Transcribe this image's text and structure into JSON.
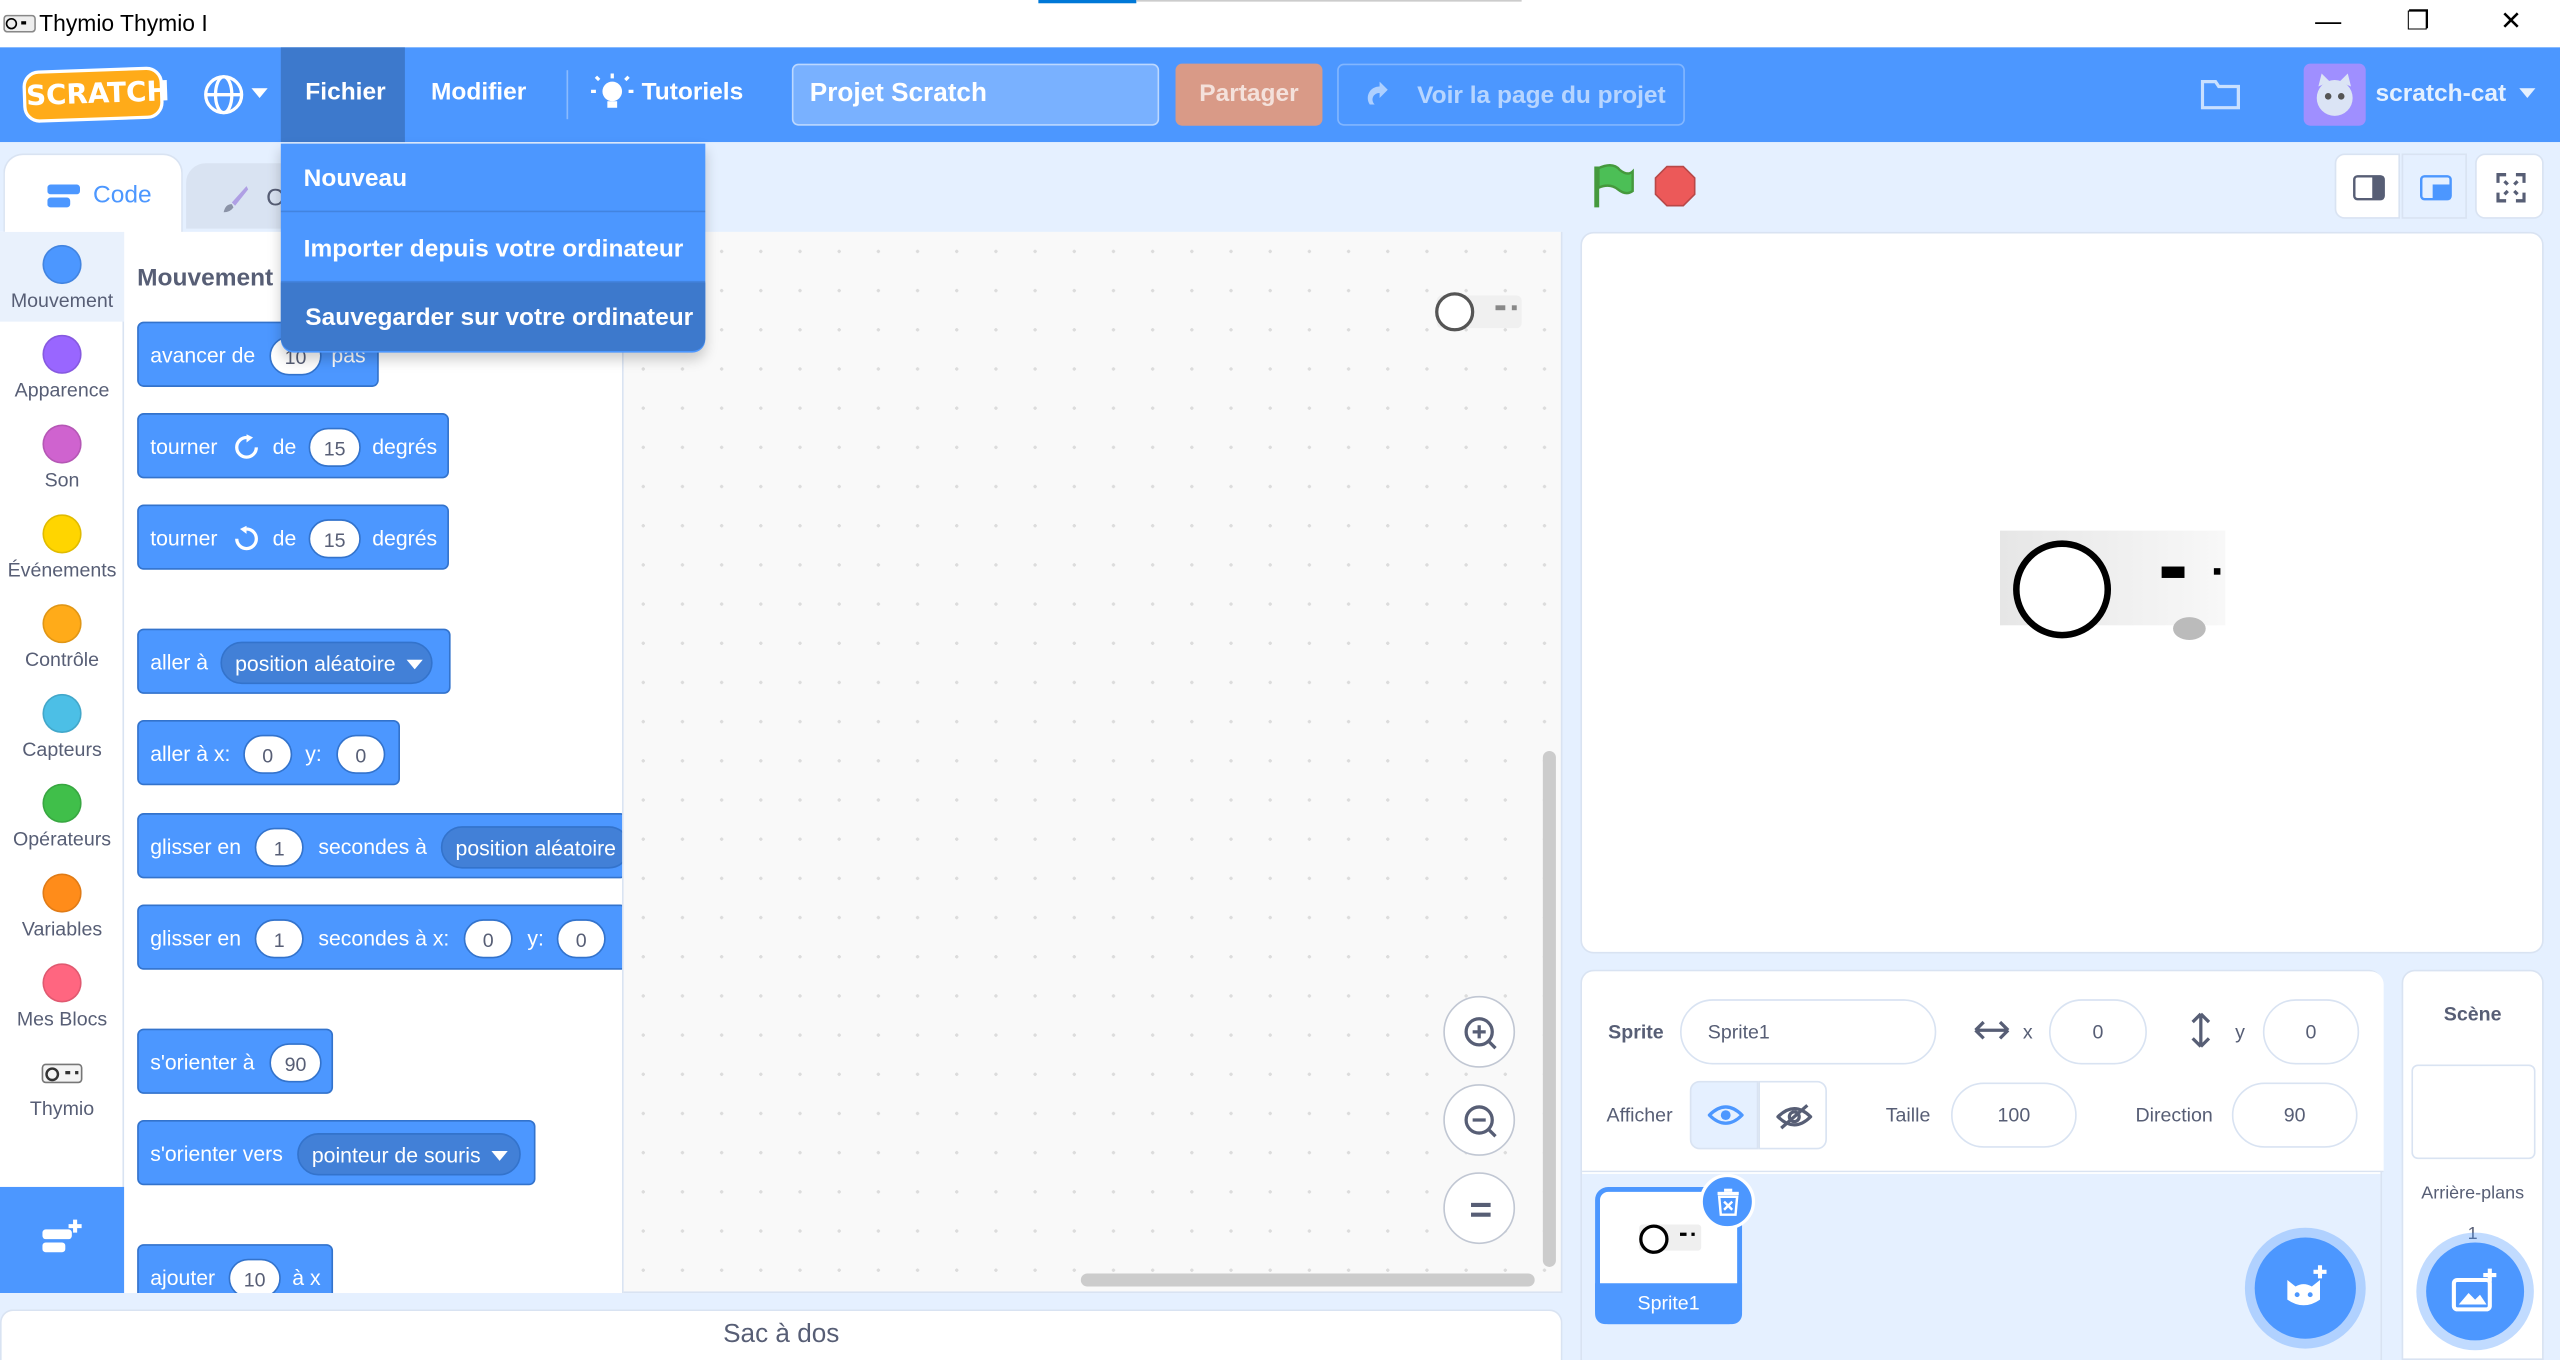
{
  "window": {
    "title": "Thymio Thymio I",
    "min": "—",
    "restore": "❐",
    "close": "✕"
  },
  "menubar": {
    "logo": "SCRATCH",
    "file": "Fichier",
    "edit": "Modifier",
    "tutorials": "Tutoriels",
    "project_title": "Projet Scratch",
    "share": "Partager",
    "see_page": "Voir la page du projet",
    "user": "scratch-cat"
  },
  "file_menu": {
    "items": [
      "Nouveau",
      "Importer depuis votre ordinateur",
      "Sauvegarder sur votre ordinateur"
    ]
  },
  "tabs": {
    "code": "Code",
    "costumes": "C"
  },
  "categories": [
    {
      "label": "Mouvement",
      "color": "#4c97ff"
    },
    {
      "label": "Apparence",
      "color": "#9966ff"
    },
    {
      "label": "Son",
      "color": "#cf63cf"
    },
    {
      "label": "Événements",
      "color": "#ffd500"
    },
    {
      "label": "Contrôle",
      "color": "#ffab19"
    },
    {
      "label": "Capteurs",
      "color": "#4cbfe6"
    },
    {
      "label": "Opérateurs",
      "color": "#40bf4a"
    },
    {
      "label": "Variables",
      "color": "#ff8c1a"
    },
    {
      "label": "Mes Blocs",
      "color": "#ff6680"
    },
    {
      "label": "Thymio",
      "color": ""
    }
  ],
  "palette": {
    "heading": "Mouvement",
    "b1": {
      "a": "avancer de",
      "v": "10",
      "b": "pas"
    },
    "b2": {
      "a": "tourner",
      "b": "de",
      "v": "15",
      "c": "degrés"
    },
    "b3": {
      "a": "tourner",
      "b": "de",
      "v": "15",
      "c": "degrés"
    },
    "b4": {
      "a": "aller à",
      "d": "position aléatoire"
    },
    "b5": {
      "a": "aller à x:",
      "v1": "0",
      "b": "y:",
      "v2": "0"
    },
    "b6": {
      "a": "glisser en",
      "v": "1",
      "b": "secondes à",
      "d": "position aléatoire"
    },
    "b7": {
      "a": "glisser en",
      "v": "1",
      "b": "secondes à x:",
      "v1": "0",
      "c": "y:",
      "v2": "0"
    },
    "b8": {
      "a": "s'orienter à",
      "v": "90"
    },
    "b9": {
      "a": "s'orienter vers",
      "d": "pointeur de souris"
    },
    "b10": {
      "a": "ajouter",
      "v": "10",
      "b": "à x"
    }
  },
  "backpack": "Sac à dos",
  "sprite_info": {
    "sprite_label": "Sprite",
    "sprite_name": "Sprite1",
    "x_label": "x",
    "x": "0",
    "y_label": "y",
    "y": "0",
    "show_label": "Afficher",
    "size_label": "Taille",
    "size": "100",
    "direction_label": "Direction",
    "direction": "90"
  },
  "sprite_tile": {
    "name": "Sprite1"
  },
  "stage_panel": {
    "title": "Scène",
    "backdrops_label": "Arrière-plans",
    "backdrops_count": "1"
  }
}
